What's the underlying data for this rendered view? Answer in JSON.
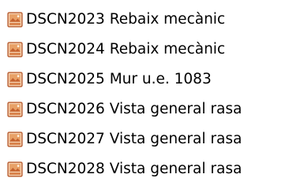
{
  "file_list": {
    "items": [
      {
        "name": "DSCN2023 Rebaix mecànic",
        "icon": "image-file-icon"
      },
      {
        "name": "DSCN2024 Rebaix mecànic",
        "icon": "image-file-icon"
      },
      {
        "name": "DSCN2025 Mur u.e. 1083",
        "icon": "image-file-icon"
      },
      {
        "name": "DSCN2026 Vista general rasa",
        "icon": "image-file-icon"
      },
      {
        "name": "DSCN2027 Vista general rasa",
        "icon": "image-file-icon"
      },
      {
        "name": "DSCN2028 Vista general rasa",
        "icon": "image-file-icon"
      }
    ]
  },
  "colors": {
    "icon_frame": "#b65a2c",
    "icon_sky": "#e8a167",
    "icon_hill": "#c5622f",
    "text": "#000000"
  }
}
